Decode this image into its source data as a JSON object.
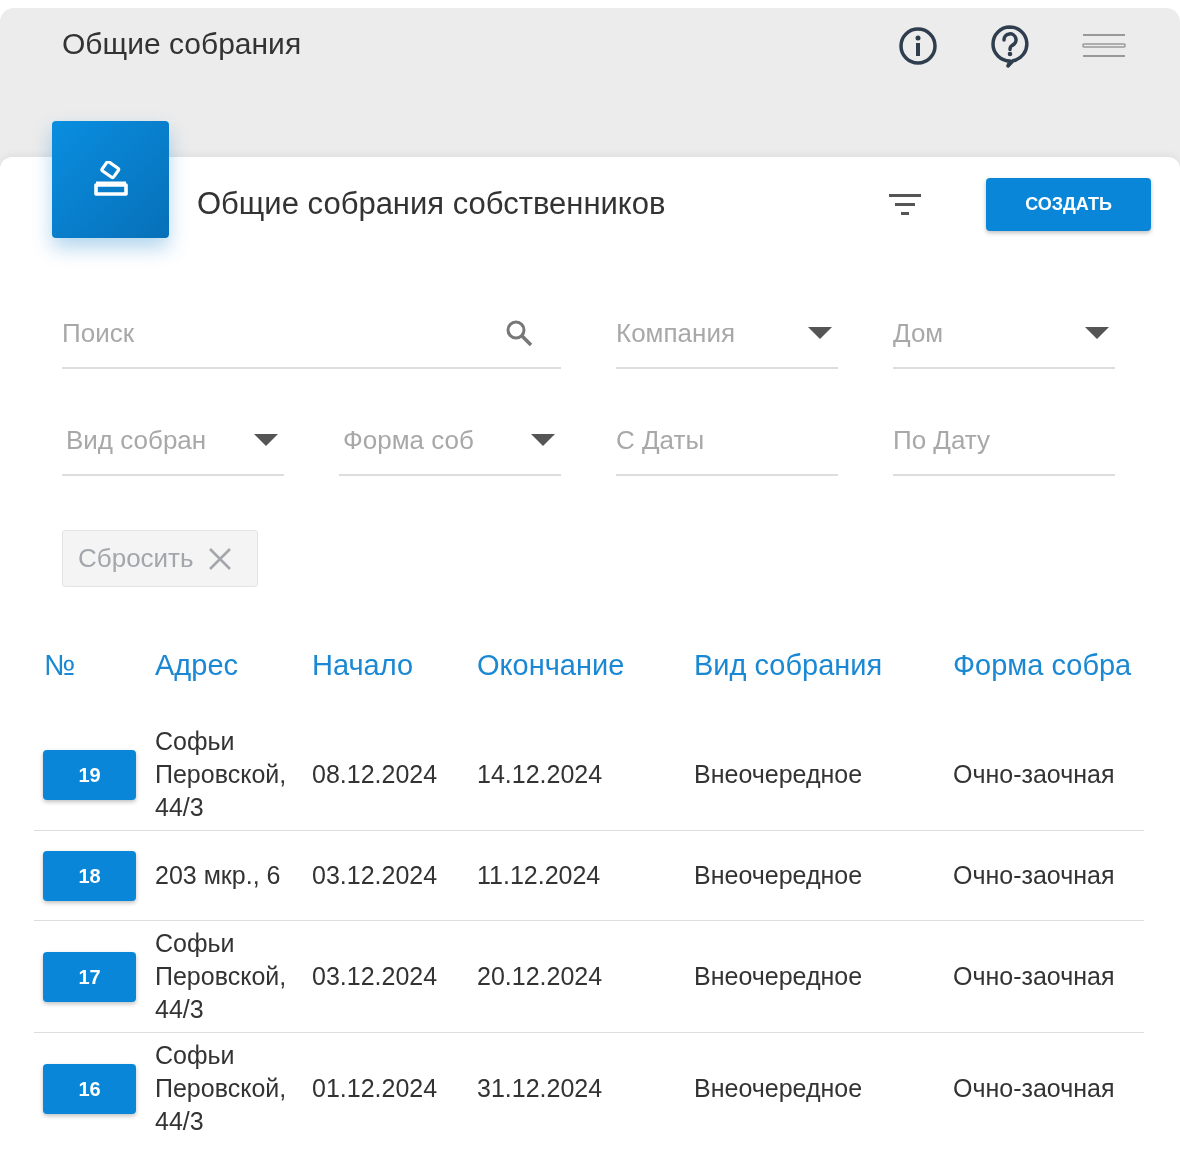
{
  "header": {
    "title": "Общие собрания"
  },
  "card": {
    "title": "Общие собрания собственников",
    "create_button": "СОЗДАТЬ"
  },
  "filters": [
    {
      "kind": "search",
      "placeholder": "Поиск"
    },
    {
      "kind": "select",
      "placeholder": "Компания"
    },
    {
      "kind": "select",
      "placeholder": "Дом"
    },
    {
      "kind": "select",
      "placeholder": "Вид собран"
    },
    {
      "kind": "select",
      "placeholder": "Форма соб"
    },
    {
      "kind": "text",
      "placeholder": "С Даты"
    },
    {
      "kind": "text",
      "placeholder": "По Дату"
    }
  ],
  "reset_button": "Сбросить",
  "table": {
    "columns": [
      "№",
      "Адрес",
      "Начало",
      "Окончание",
      "Вид собрания",
      "Форма собра"
    ],
    "rows": [
      {
        "number": "19",
        "address": "Софьи Перовской, 44/3",
        "start": "08.12.2024",
        "end": "14.12.2024",
        "kind": "Внеочередное",
        "form": "Очно-заочная"
      },
      {
        "number": "18",
        "address": "203 мкр., 6",
        "start": "03.12.2024",
        "end": "11.12.2024",
        "kind": "Внеочередное",
        "form": "Очно-заочная"
      },
      {
        "number": "17",
        "address": "Софьи Перовской, 44/3",
        "start": "03.12.2024",
        "end": "20.12.2024",
        "kind": "Внеочередное",
        "form": "Очно-заочная"
      },
      {
        "number": "16",
        "address": "Софьи Перовской, 44/3",
        "start": "01.12.2024",
        "end": "31.12.2024",
        "kind": "Внеочередное",
        "form": "Очно-заочная"
      }
    ]
  }
}
